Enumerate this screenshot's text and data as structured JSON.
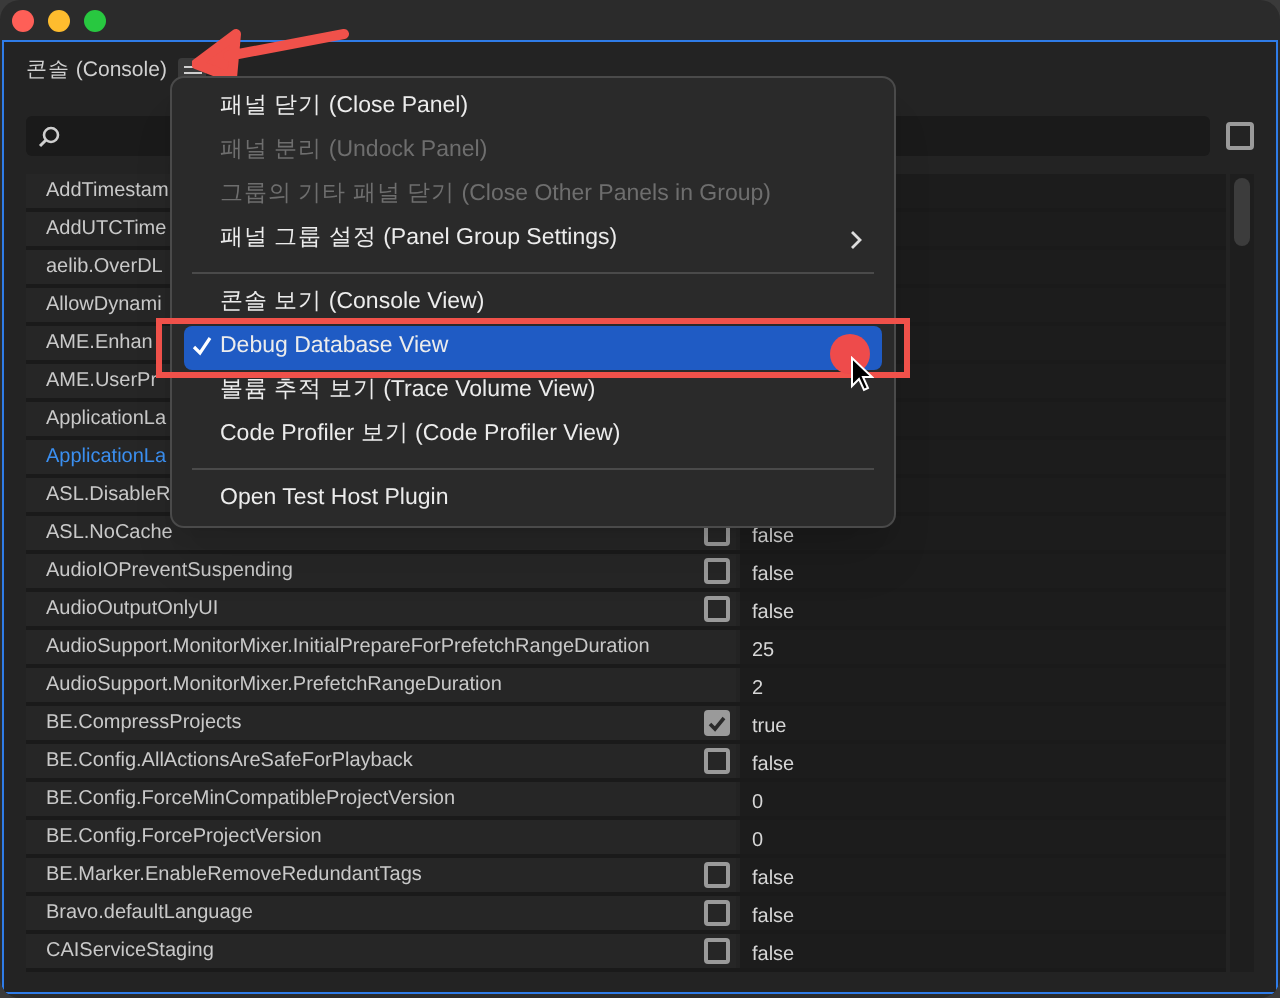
{
  "panel": {
    "title": "콘솔 (Console)"
  },
  "filter_checkbox": {
    "checked": false
  },
  "rows": [
    {
      "key": "AddTimestam",
      "selected": false
    },
    {
      "key": "AddUTCTime",
      "selected": false
    },
    {
      "key": "aelib.OverDL",
      "selected": false
    },
    {
      "key": "AllowDynami",
      "selected": false
    },
    {
      "key": "AME.Enhan",
      "selected": false
    },
    {
      "key": "AME.UserPr",
      "selected": false
    },
    {
      "key": "ApplicationLa",
      "selected": false
    },
    {
      "key": "ApplicationLa",
      "selected": true
    },
    {
      "key": "ASL.DisableR",
      "selected": false
    },
    {
      "key": "ASL.NoCache",
      "selected": false,
      "kind": "bool",
      "checked": false,
      "value": "false"
    },
    {
      "key": "AudioIOPreventSuspending",
      "selected": false,
      "kind": "bool",
      "checked": false,
      "value": "false"
    },
    {
      "key": "AudioOutputOnlyUI",
      "selected": false,
      "kind": "bool",
      "checked": false,
      "value": "false"
    },
    {
      "key": "AudioSupport.MonitorMixer.InitialPrepareForPrefetchRangeDuration",
      "selected": false,
      "kind": "number",
      "value": "25"
    },
    {
      "key": "AudioSupport.MonitorMixer.PrefetchRangeDuration",
      "selected": false,
      "kind": "number",
      "value": "2"
    },
    {
      "key": "BE.CompressProjects",
      "selected": false,
      "kind": "bool",
      "checked": true,
      "value": "true"
    },
    {
      "key": "BE.Config.AllActionsAreSafeForPlayback",
      "selected": false,
      "kind": "bool",
      "checked": false,
      "value": "false"
    },
    {
      "key": "BE.Config.ForceMinCompatibleProjectVersion",
      "selected": false,
      "kind": "number",
      "value": "0"
    },
    {
      "key": "BE.Config.ForceProjectVersion",
      "selected": false,
      "kind": "number",
      "value": "0"
    },
    {
      "key": "BE.Marker.EnableRemoveRedundantTags",
      "selected": false,
      "kind": "bool",
      "checked": false,
      "value": "false"
    },
    {
      "key": "Bravo.defaultLanguage",
      "selected": false,
      "kind": "bool",
      "checked": false,
      "value": "false"
    },
    {
      "key": "CAIServiceStaging",
      "selected": false,
      "kind": "bool",
      "checked": false,
      "value": "false"
    }
  ],
  "menu": [
    {
      "kind": "item",
      "label": "패널 닫기 (Close Panel)",
      "disabled": false,
      "checked": false,
      "selected": false,
      "submenu": false
    },
    {
      "kind": "item",
      "label": "패널 분리 (Undock Panel)",
      "disabled": true,
      "checked": false,
      "selected": false,
      "submenu": false
    },
    {
      "kind": "item",
      "label": "그룹의 기타 패널 닫기 (Close Other Panels in Group)",
      "disabled": true,
      "checked": false,
      "selected": false,
      "submenu": false
    },
    {
      "kind": "item",
      "label": "패널 그룹 설정 (Panel Group Settings)",
      "disabled": false,
      "checked": false,
      "selected": false,
      "submenu": true
    },
    {
      "kind": "separator"
    },
    {
      "kind": "item",
      "label": "콘솔 보기 (Console View)",
      "disabled": false,
      "checked": false,
      "selected": false,
      "submenu": false
    },
    {
      "kind": "item",
      "label": "Debug Database View",
      "disabled": false,
      "checked": true,
      "selected": true,
      "submenu": false
    },
    {
      "kind": "item",
      "label": "볼륨 추적 보기 (Trace Volume View)",
      "disabled": false,
      "checked": false,
      "selected": false,
      "submenu": false
    },
    {
      "kind": "item",
      "label": "Code Profiler 보기 (Code Profiler View)",
      "disabled": false,
      "checked": false,
      "selected": false,
      "submenu": false
    },
    {
      "kind": "separator"
    },
    {
      "kind": "item",
      "label": "Open Test Host Plugin",
      "disabled": false,
      "checked": false,
      "selected": false,
      "submenu": false
    }
  ]
}
